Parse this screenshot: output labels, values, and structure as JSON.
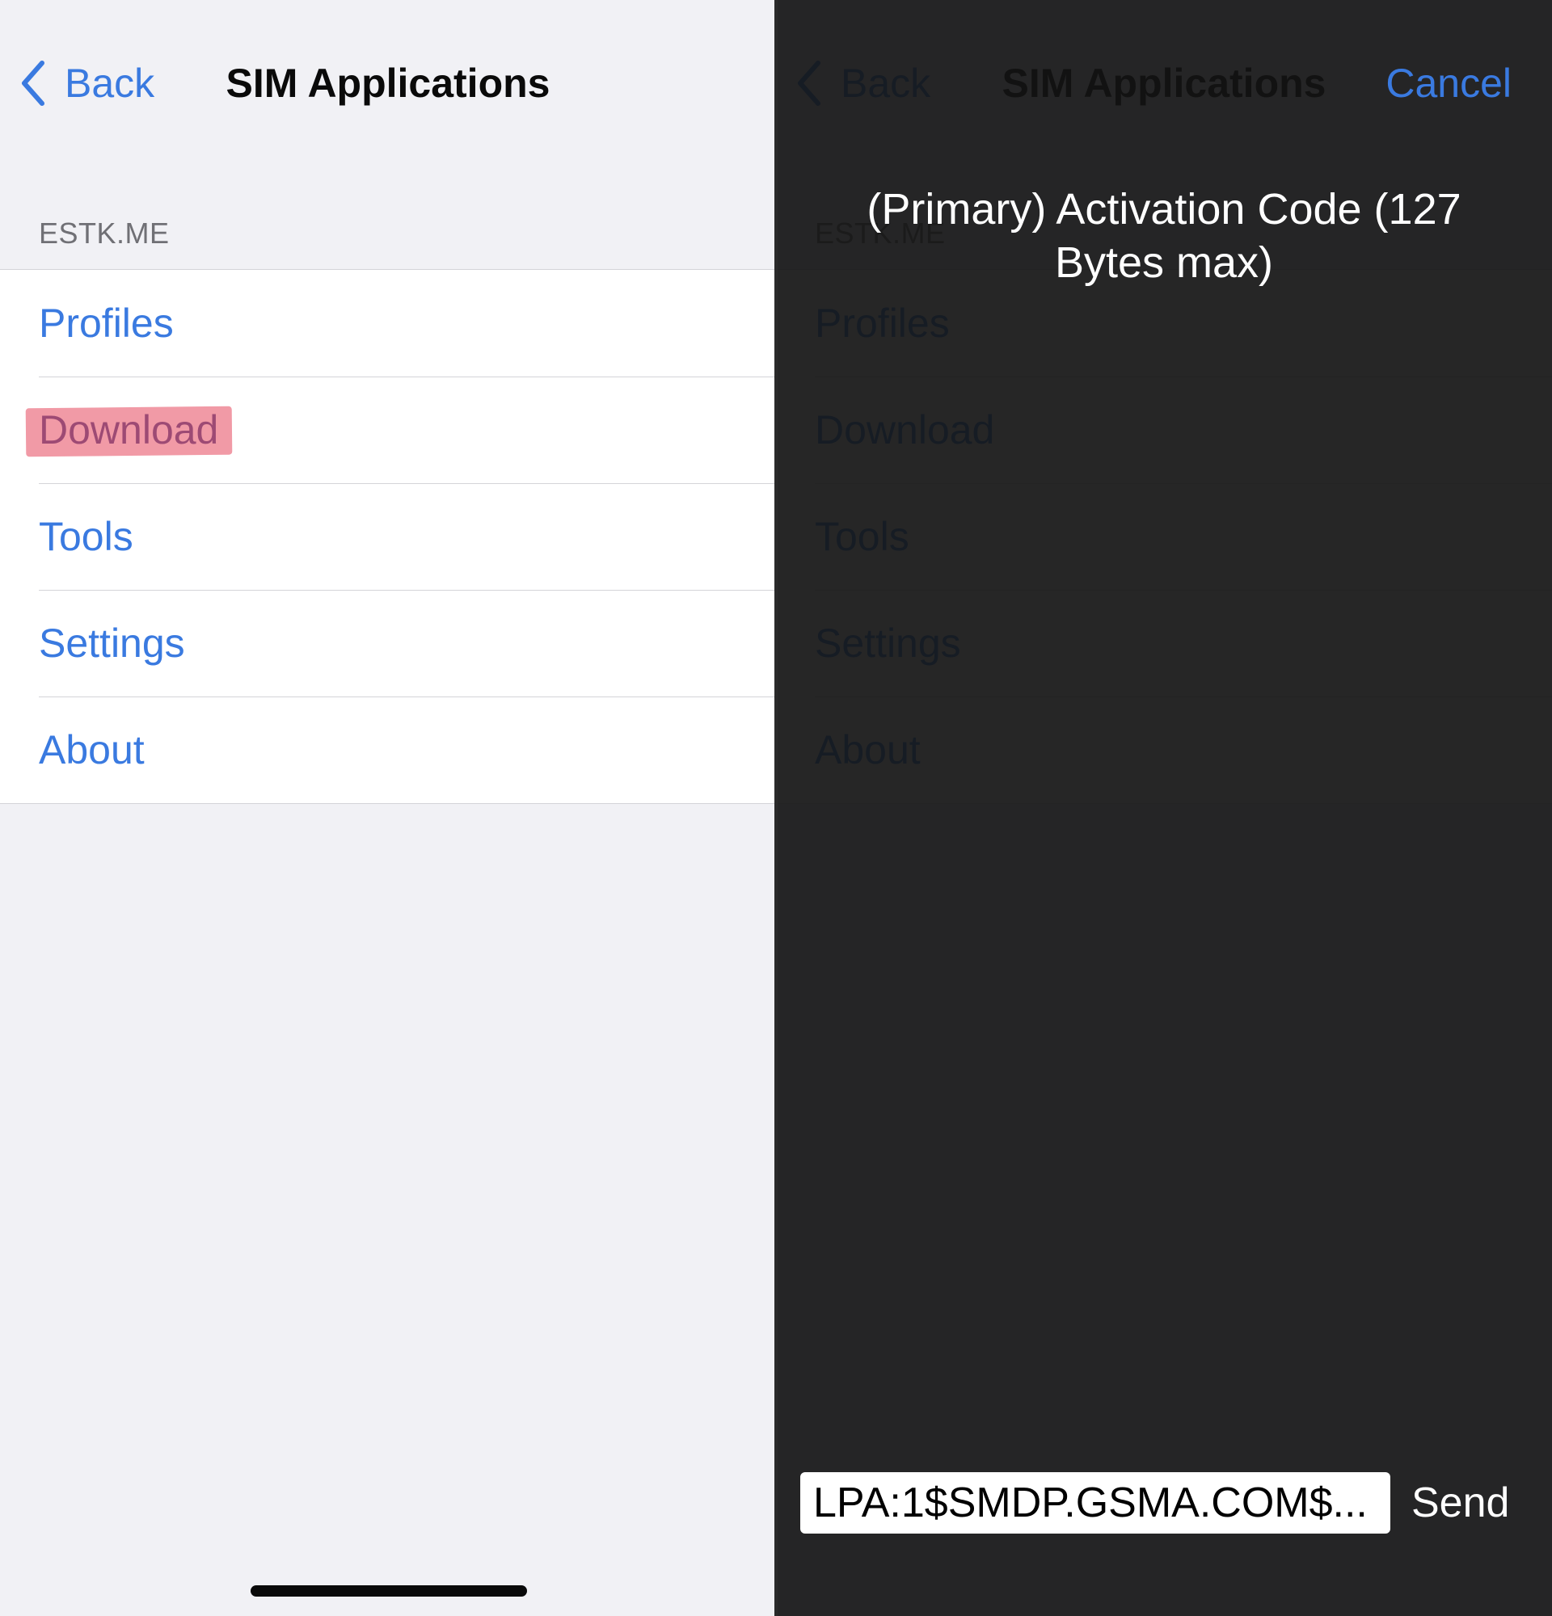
{
  "app": {
    "nav": {
      "back_label": "Back",
      "title": "SIM Applications",
      "cancel_label": "Cancel"
    },
    "section_header": "ESTK.ME",
    "menu_items": [
      {
        "label": "Profiles"
      },
      {
        "label": "Download"
      },
      {
        "label": "Tools"
      },
      {
        "label": "Settings"
      },
      {
        "label": "About"
      }
    ],
    "highlighted_item": "Download"
  },
  "dialog": {
    "prompt": "(Primary) Activation Code (127 Bytes max)",
    "input_value": "LPA:1$SMDP.GSMA.COM$...",
    "send_label": "Send"
  },
  "colors": {
    "accent": "#3a7ae0",
    "background": "#f1f1f5",
    "highlight": "#f19aa6",
    "overlay": "#141414"
  },
  "icons": {
    "back": "chevron-left-icon"
  }
}
